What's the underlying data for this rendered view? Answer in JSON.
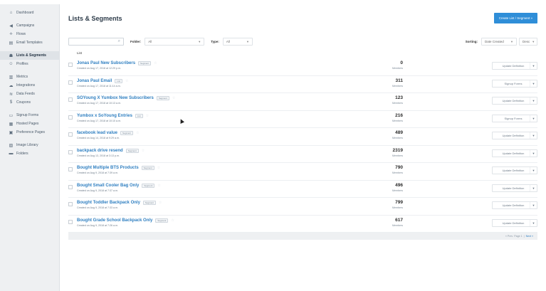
{
  "sidebar": {
    "groups": [
      [
        {
          "icon": "home-icon",
          "glyph": "⌂",
          "label": "Dashboard"
        }
      ],
      [
        {
          "icon": "megaphone-icon",
          "glyph": "◀",
          "label": "Campaigns"
        },
        {
          "icon": "flows-icon",
          "glyph": "⟡",
          "label": "Flows"
        },
        {
          "icon": "template-icon",
          "glyph": "▤",
          "label": "Email Templates"
        }
      ],
      [
        {
          "icon": "users-icon",
          "glyph": "☗",
          "label": "Lists & Segments",
          "active": true
        },
        {
          "icon": "profile-icon",
          "glyph": "☺",
          "label": "Profiles"
        }
      ],
      [
        {
          "icon": "metrics-icon",
          "glyph": "▥",
          "label": "Metrics"
        },
        {
          "icon": "cloud-icon",
          "glyph": "☁",
          "label": "Integrations"
        },
        {
          "icon": "datafeed-icon",
          "glyph": "≋",
          "label": "Data Feeds"
        },
        {
          "icon": "dollar-icon",
          "glyph": "$",
          "label": "Coupons"
        }
      ],
      [
        {
          "icon": "form-icon",
          "glyph": "▭",
          "label": "Signup Forms"
        },
        {
          "icon": "building-icon",
          "glyph": "▦",
          "label": "Hosted Pages"
        },
        {
          "icon": "preference-icon",
          "glyph": "▣",
          "label": "Preference Pages"
        }
      ],
      [
        {
          "icon": "image-icon",
          "glyph": "▨",
          "label": "Image Library"
        },
        {
          "icon": "folder-icon",
          "glyph": "▬",
          "label": "Folders"
        }
      ]
    ]
  },
  "header": {
    "title": "Lists & Segments",
    "create_button": "Create List / Segment »"
  },
  "filters": {
    "search_placeholder": "",
    "folder_label": "Folder:",
    "folder_value": "All",
    "type_label": "Type:",
    "type_value": "All",
    "sorting_label": "Sorting:",
    "sort_value": "Date Created",
    "order_value": "Desc"
  },
  "list_header": "List",
  "rows": [
    {
      "name": "Jonas Paul New Subscribers",
      "tag": "Segment",
      "created": "Created on Aug 17, 2018 at 12:29 p.m.",
      "count": "0",
      "members": "Members",
      "action": "Update Definition"
    },
    {
      "name": "Jonas Paul Email",
      "tag": "List",
      "created": "Created on Aug 17, 2018 at 11:14 a.m.",
      "count": "311",
      "members": "Members",
      "action": "Signup Forms"
    },
    {
      "name": "SOYoung X Yumbox New Subscribers",
      "tag": "Segment",
      "created": "Created on Aug 17, 2018 at 10:13 a.m.",
      "count": "123",
      "members": "Members",
      "action": "Update Definition"
    },
    {
      "name": "Yumbox x SoYoung Entries",
      "tag": "List",
      "created": "Created on Aug 17, 2018 at 10:10 a.m.",
      "count": "216",
      "members": "Members",
      "action": "Signup Forms"
    },
    {
      "name": "facebook lead value",
      "tag": "Segment",
      "created": "Created on Aug 14, 2018 at 9:29 a.m.",
      "count": "489",
      "members": "Members",
      "action": "Update Definition"
    },
    {
      "name": "backpack drive resend",
      "tag": "Segment",
      "created": "Created on Aug 13, 2018 at 3:13 p.m.",
      "count": "2319",
      "members": "Members",
      "action": "Update Definition"
    },
    {
      "name": "Bought Multiple BTS Products",
      "tag": "Segment",
      "created": "Created on Aug 9, 2018 at 7:39 a.m.",
      "count": "790",
      "members": "Members",
      "action": "Update Definition"
    },
    {
      "name": "Bought Small Cooler Bag Only",
      "tag": "Segment",
      "created": "Created on Aug 9, 2018 at 7:37 a.m.",
      "count": "496",
      "members": "Members",
      "action": "Update Definition"
    },
    {
      "name": "Bought Toddler Backpack Only",
      "tag": "Segment",
      "created": "Created on Aug 9, 2018 at 7:33 a.m.",
      "count": "799",
      "members": "Members",
      "action": "Update Definition"
    },
    {
      "name": "Bought Grade School Backpack Only",
      "tag": "Segment",
      "created": "Created on Aug 9, 2018 at 7:26 a.m.",
      "count": "617",
      "members": "Members",
      "action": "Update Definition"
    }
  ],
  "pagination": {
    "prev": "« Prev",
    "page": "Page 1",
    "next": "Next »"
  },
  "colors": {
    "accent": "#2f8ed8",
    "link": "#2f7fc1"
  }
}
